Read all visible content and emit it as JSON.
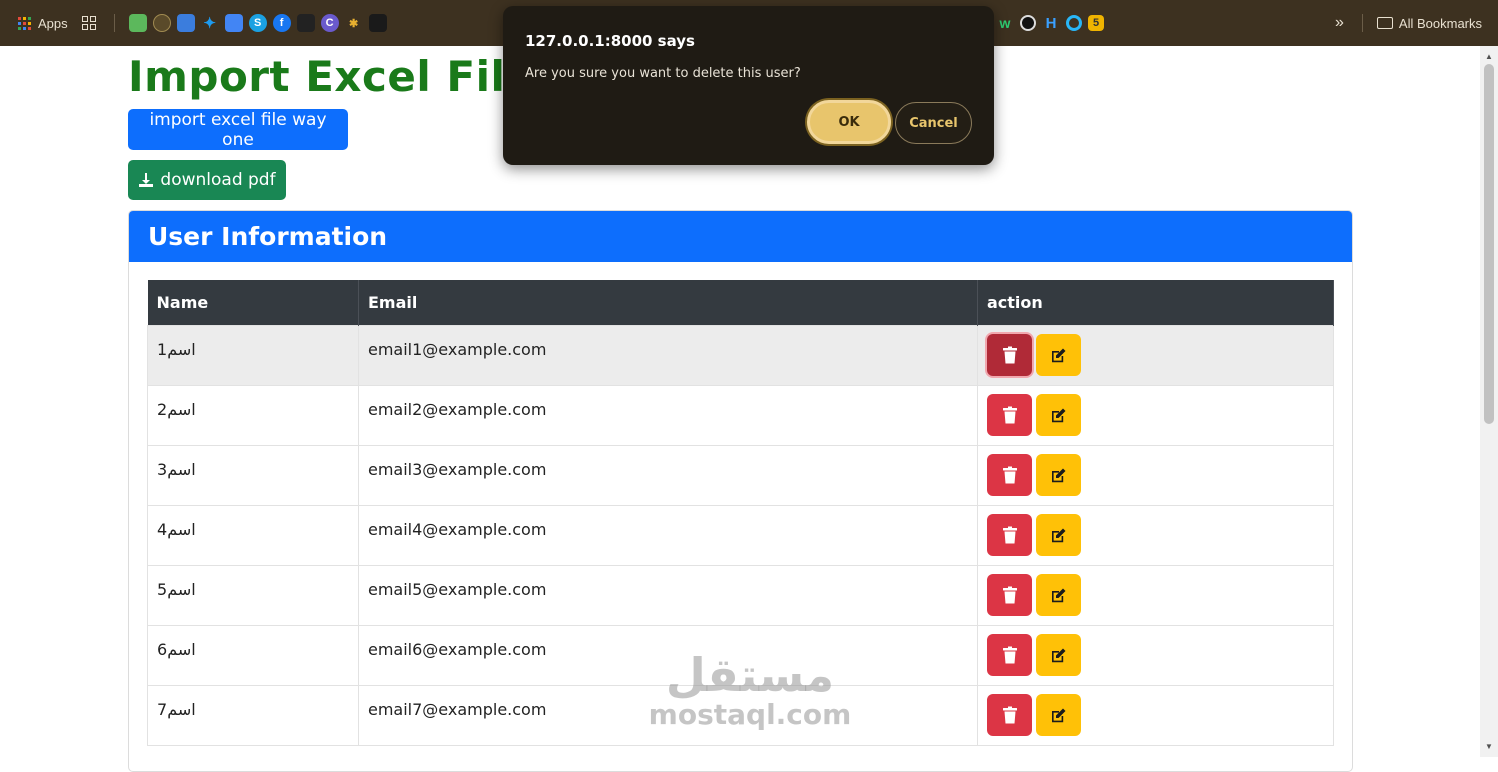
{
  "bookmarks": {
    "apps_label": "Apps",
    "all_bookmarks_label": "All Bookmarks"
  },
  "page": {
    "title_visible": "Import Excel File ar",
    "import_button": "import excel file way one",
    "pdf_button": "download pdf"
  },
  "card": {
    "title": "User Information"
  },
  "table": {
    "headers": [
      "Name",
      "Email",
      "action"
    ],
    "rows": [
      {
        "name": "اسم1",
        "email": "email1@example.com"
      },
      {
        "name": "اسم2",
        "email": "email2@example.com"
      },
      {
        "name": "اسم3",
        "email": "email3@example.com"
      },
      {
        "name": "اسم4",
        "email": "email4@example.com"
      },
      {
        "name": "اسم5",
        "email": "email5@example.com"
      },
      {
        "name": "اسم6",
        "email": "email6@example.com"
      },
      {
        "name": "اسم7",
        "email": "email7@example.com"
      }
    ]
  },
  "dialog": {
    "origin": "127.0.0.1:8000 says",
    "message": "Are you sure you want to delete this user?",
    "ok": "OK",
    "cancel": "Cancel"
  },
  "watermark": {
    "arabic": "مستقل",
    "latin": "mostaql.com"
  },
  "colors": {
    "title_green": "#1a7a1a",
    "primary_blue": "#0d6efd",
    "success_green": "#198754",
    "danger_red": "#dc3545",
    "warning_yellow": "#ffc107",
    "dialog_bg": "#1f1b14"
  }
}
